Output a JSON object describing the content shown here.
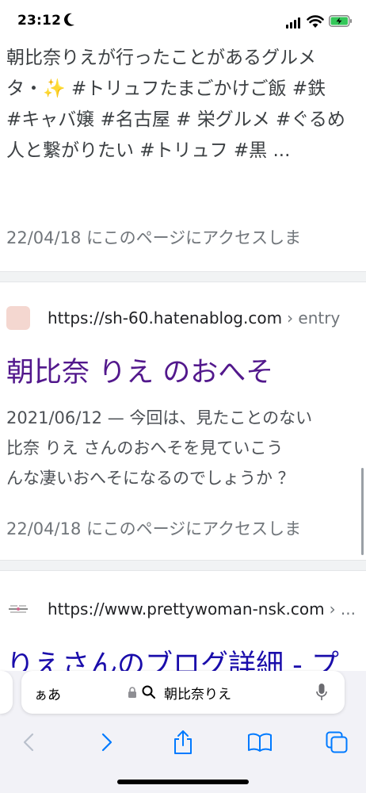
{
  "status_bar": {
    "time": "23:12"
  },
  "results": [
    {
      "snippet_lines": [
        "朝比奈りえが行ったことがあるグルメ",
        "タ・✨ #トリュフたまごかけご飯 #鉄",
        "#キャバ嬢 #名古屋 # 栄グルメ #ぐるめ",
        "人と繋がりたい #トリュフ #黒 ..."
      ],
      "visited": "22/04/18 にこのページにアクセスしま"
    },
    {
      "url": "https://sh-60.hatenablog.com",
      "crumb": "› entry",
      "title": "朝比奈 りえ のおへそ",
      "snippet_lines": [
        "2021/06/12 — 今回は、見たことのない",
        "比奈 りえ さんのおへそを見ていこう",
        "んな凄いおへそになるのでしょうか ？"
      ],
      "visited": "22/04/18 にこのページにアクセスしま"
    },
    {
      "url": "https://www.prettywoman-nsk.com",
      "crumb": "› ...",
      "title": "りえさんのブログ詳細 - プ"
    }
  ],
  "address_bar": {
    "aa": "ぁあ",
    "query": "朝比奈りえ"
  },
  "colors": {
    "visited_link": "#52188c",
    "link": "#1a0dab",
    "toolbar_tint": "#007aff"
  }
}
